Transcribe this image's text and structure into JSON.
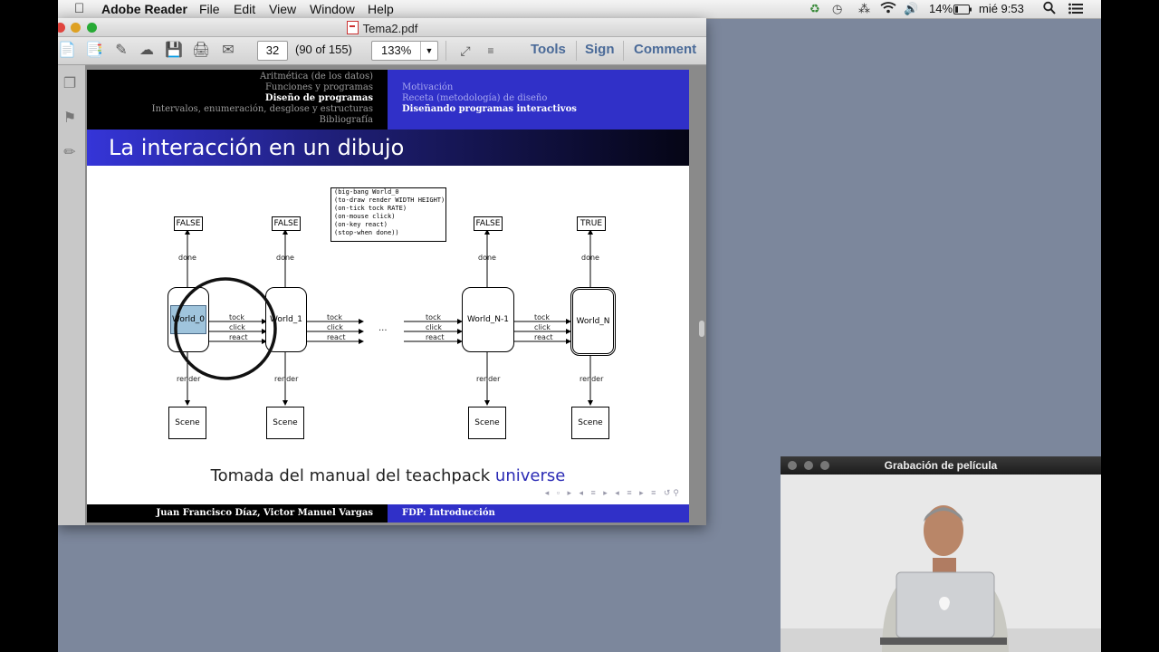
{
  "menubar": {
    "app_name": "Adobe Reader",
    "menus": [
      "File",
      "Edit",
      "View",
      "Window",
      "Help"
    ],
    "battery": "14%",
    "clock": "mié 9:53"
  },
  "window": {
    "title": "Tema2.pdf"
  },
  "toolbar": {
    "page_number": "32",
    "page_count": "(90 of 155)",
    "zoom": "133%",
    "tools_label": "Tools",
    "sign_label": "Sign",
    "comment_label": "Comment"
  },
  "slide": {
    "nav_left": [
      "Aritmética (de los datos)",
      "Funciones y programas",
      "Diseño de programas",
      "Intervalos, enumeración, desglose y estructuras",
      "Bibliografía"
    ],
    "nav_right": [
      "Motivación",
      "Receta (metodología) de diseño",
      "Diseñando programas interactivos"
    ],
    "title": "La interacción en un dibujo",
    "diagram": {
      "booleans": [
        "FALSE",
        "FALSE",
        "FALSE",
        "TRUE"
      ],
      "worlds": [
        "World_0",
        "World_1",
        "World_N-1",
        "World_N"
      ],
      "done_label": "done",
      "render_label": "render",
      "scene_label": "Scene",
      "tock_label": "tock",
      "click_label": "click",
      "react_label": "react",
      "ellipsis": "...",
      "code": [
        "(big-bang World_0",
        "  (to-draw render WIDTH HEIGHT)",
        "  (on-tick tock RATE)",
        "  (on-mouse click)",
        "  (on-key react)",
        "  (stop-when done))"
      ]
    },
    "caption_prefix": "Tomada del manual del teachpack ",
    "caption_keyword": "universe",
    "footer_left": "Juan Francisco Díaz, Victor Manuel Vargas",
    "footer_right": "FDP: Introducción"
  },
  "movie_window": {
    "title": "Grabación de película"
  }
}
